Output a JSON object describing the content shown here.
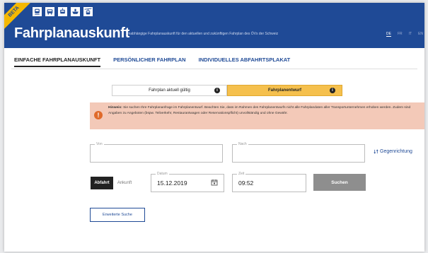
{
  "header": {
    "beta": "BETA",
    "title": "Fahrplanauskunft",
    "subtitle": "Unabhängige Fahrplanauskunft für den aktuellen und zukünftigen Fahrplan des ÖVs der Schweiz",
    "languages": [
      "DE",
      "FR",
      "IT",
      "EN"
    ],
    "active_language": "DE",
    "transport_icons": [
      "train-icon",
      "bus-icon",
      "tram-icon",
      "ship-icon",
      "cableway-icon"
    ]
  },
  "tabs": [
    {
      "label": "EINFACHE FAHRPLANAUSKUNFT",
      "active": true
    },
    {
      "label": "PERSÖNLICHER FAHRPLAN",
      "active": false
    },
    {
      "label": "INDIVIDUELLES ABFAHRTSPLAKAT",
      "active": false
    }
  ],
  "timetable_toggle": {
    "left": "Fahrplan aktuell gültig",
    "right": "Fahrplanentwurf",
    "selected": "right",
    "info_glyph": "i"
  },
  "notice": {
    "glyph": "!",
    "strong": "Hinweis:",
    "text": "Sie suchen Ihre Fahrplananfrage im Fahrplanentwurf. Beachten Sie, dass im Rahmen des Fahrplanentwurfs nicht alle Fahrplandaten aller Transportunternehmen erhoben werden. Zudem sind Angaben zu Angeboten (bspw. Teilverkehr, Restaurantwagen oder Reservationspflicht) unvollständig und ohne Gewähr."
  },
  "form": {
    "from_label": "Von",
    "from_value": "",
    "to_label": "Nach",
    "to_value": "",
    "swap_label": "Gegenrichtung",
    "departure_label": "Abfahrt",
    "arrival_label": "Ankunft",
    "selected_mode": "Abfahrt",
    "date_label": "Datum",
    "date_value": "15.12.2019",
    "time_label": "Zeit",
    "time_value": "09:52",
    "search_label": "Suchen",
    "extended_search_label": "Erweiterte Suche"
  },
  "colors": {
    "brand_blue": "#1f4a96",
    "accent_yellow": "#f5c04d",
    "notice_bg": "#f3c9b8",
    "notice_icon": "#e06a2a"
  }
}
